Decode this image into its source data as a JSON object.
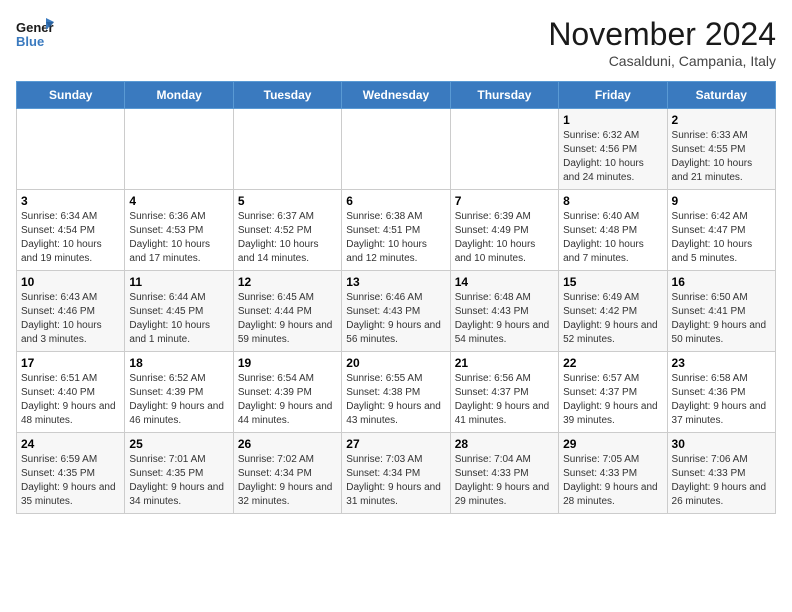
{
  "header": {
    "logo_line1": "General",
    "logo_line2": "Blue",
    "month": "November 2024",
    "location": "Casalduni, Campania, Italy"
  },
  "weekdays": [
    "Sunday",
    "Monday",
    "Tuesday",
    "Wednesday",
    "Thursday",
    "Friday",
    "Saturday"
  ],
  "weeks": [
    [
      {
        "day": "",
        "info": ""
      },
      {
        "day": "",
        "info": ""
      },
      {
        "day": "",
        "info": ""
      },
      {
        "day": "",
        "info": ""
      },
      {
        "day": "",
        "info": ""
      },
      {
        "day": "1",
        "info": "Sunrise: 6:32 AM\nSunset: 4:56 PM\nDaylight: 10 hours and 24 minutes."
      },
      {
        "day": "2",
        "info": "Sunrise: 6:33 AM\nSunset: 4:55 PM\nDaylight: 10 hours and 21 minutes."
      }
    ],
    [
      {
        "day": "3",
        "info": "Sunrise: 6:34 AM\nSunset: 4:54 PM\nDaylight: 10 hours and 19 minutes."
      },
      {
        "day": "4",
        "info": "Sunrise: 6:36 AM\nSunset: 4:53 PM\nDaylight: 10 hours and 17 minutes."
      },
      {
        "day": "5",
        "info": "Sunrise: 6:37 AM\nSunset: 4:52 PM\nDaylight: 10 hours and 14 minutes."
      },
      {
        "day": "6",
        "info": "Sunrise: 6:38 AM\nSunset: 4:51 PM\nDaylight: 10 hours and 12 minutes."
      },
      {
        "day": "7",
        "info": "Sunrise: 6:39 AM\nSunset: 4:49 PM\nDaylight: 10 hours and 10 minutes."
      },
      {
        "day": "8",
        "info": "Sunrise: 6:40 AM\nSunset: 4:48 PM\nDaylight: 10 hours and 7 minutes."
      },
      {
        "day": "9",
        "info": "Sunrise: 6:42 AM\nSunset: 4:47 PM\nDaylight: 10 hours and 5 minutes."
      }
    ],
    [
      {
        "day": "10",
        "info": "Sunrise: 6:43 AM\nSunset: 4:46 PM\nDaylight: 10 hours and 3 minutes."
      },
      {
        "day": "11",
        "info": "Sunrise: 6:44 AM\nSunset: 4:45 PM\nDaylight: 10 hours and 1 minute."
      },
      {
        "day": "12",
        "info": "Sunrise: 6:45 AM\nSunset: 4:44 PM\nDaylight: 9 hours and 59 minutes."
      },
      {
        "day": "13",
        "info": "Sunrise: 6:46 AM\nSunset: 4:43 PM\nDaylight: 9 hours and 56 minutes."
      },
      {
        "day": "14",
        "info": "Sunrise: 6:48 AM\nSunset: 4:43 PM\nDaylight: 9 hours and 54 minutes."
      },
      {
        "day": "15",
        "info": "Sunrise: 6:49 AM\nSunset: 4:42 PM\nDaylight: 9 hours and 52 minutes."
      },
      {
        "day": "16",
        "info": "Sunrise: 6:50 AM\nSunset: 4:41 PM\nDaylight: 9 hours and 50 minutes."
      }
    ],
    [
      {
        "day": "17",
        "info": "Sunrise: 6:51 AM\nSunset: 4:40 PM\nDaylight: 9 hours and 48 minutes."
      },
      {
        "day": "18",
        "info": "Sunrise: 6:52 AM\nSunset: 4:39 PM\nDaylight: 9 hours and 46 minutes."
      },
      {
        "day": "19",
        "info": "Sunrise: 6:54 AM\nSunset: 4:39 PM\nDaylight: 9 hours and 44 minutes."
      },
      {
        "day": "20",
        "info": "Sunrise: 6:55 AM\nSunset: 4:38 PM\nDaylight: 9 hours and 43 minutes."
      },
      {
        "day": "21",
        "info": "Sunrise: 6:56 AM\nSunset: 4:37 PM\nDaylight: 9 hours and 41 minutes."
      },
      {
        "day": "22",
        "info": "Sunrise: 6:57 AM\nSunset: 4:37 PM\nDaylight: 9 hours and 39 minutes."
      },
      {
        "day": "23",
        "info": "Sunrise: 6:58 AM\nSunset: 4:36 PM\nDaylight: 9 hours and 37 minutes."
      }
    ],
    [
      {
        "day": "24",
        "info": "Sunrise: 6:59 AM\nSunset: 4:35 PM\nDaylight: 9 hours and 35 minutes."
      },
      {
        "day": "25",
        "info": "Sunrise: 7:01 AM\nSunset: 4:35 PM\nDaylight: 9 hours and 34 minutes."
      },
      {
        "day": "26",
        "info": "Sunrise: 7:02 AM\nSunset: 4:34 PM\nDaylight: 9 hours and 32 minutes."
      },
      {
        "day": "27",
        "info": "Sunrise: 7:03 AM\nSunset: 4:34 PM\nDaylight: 9 hours and 31 minutes."
      },
      {
        "day": "28",
        "info": "Sunrise: 7:04 AM\nSunset: 4:33 PM\nDaylight: 9 hours and 29 minutes."
      },
      {
        "day": "29",
        "info": "Sunrise: 7:05 AM\nSunset: 4:33 PM\nDaylight: 9 hours and 28 minutes."
      },
      {
        "day": "30",
        "info": "Sunrise: 7:06 AM\nSunset: 4:33 PM\nDaylight: 9 hours and 26 minutes."
      }
    ]
  ]
}
